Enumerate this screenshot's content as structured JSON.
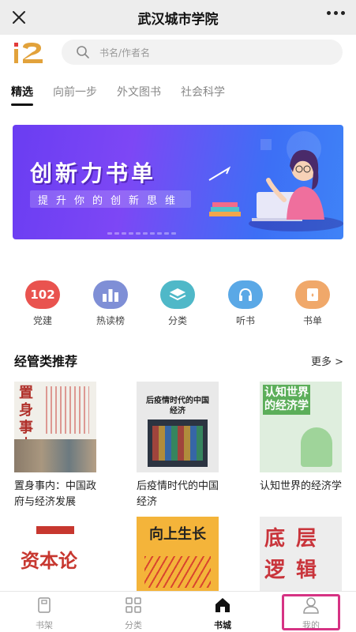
{
  "header": {
    "title": "武汉城市学院"
  },
  "logo": {
    "text": "i2"
  },
  "search": {
    "placeholder": "书名/作者名"
  },
  "tabs": [
    {
      "label": "精选",
      "active": true
    },
    {
      "label": "向前一步",
      "active": false
    },
    {
      "label": "外文图书",
      "active": false
    },
    {
      "label": "社会科学",
      "active": false
    }
  ],
  "banner": {
    "title": "创新力书单",
    "subtitle": "提升你的创新思维"
  },
  "quick_links": [
    {
      "label": "党建",
      "badge": "102",
      "color": "#e9534f",
      "icon": "party-badge-icon"
    },
    {
      "label": "热读榜",
      "color": "#7f8fd6",
      "icon": "ranking-icon"
    },
    {
      "label": "分类",
      "color": "#4fb8c8",
      "icon": "layers-icon"
    },
    {
      "label": "听书",
      "color": "#5aa8e6",
      "icon": "headphones-icon"
    },
    {
      "label": "书单",
      "color": "#f0a86a",
      "icon": "booklist-icon"
    }
  ],
  "section": {
    "title": "经管类推荐",
    "more": "更多 >"
  },
  "books": [
    {
      "title": "置身事内：中国政府与经济发展",
      "cover_text": "置身事内"
    },
    {
      "title": "后疫情时代的中国经济",
      "cover_text": "后疫情时代的中国经济"
    },
    {
      "title": "认知世界的经济学",
      "cover_text": "认知世界的经济学"
    },
    {
      "title": "",
      "cover_text": "资本论"
    },
    {
      "title": "",
      "cover_text": "向上生长"
    },
    {
      "title": "",
      "cover_text": "底层逻辑"
    }
  ],
  "bottom_nav": [
    {
      "label": "书架",
      "icon": "bookshelf-icon",
      "active": false
    },
    {
      "label": "分类",
      "icon": "category-grid-icon",
      "active": false
    },
    {
      "label": "书城",
      "icon": "home-icon",
      "active": true
    },
    {
      "label": "我的",
      "icon": "user-icon",
      "active": false
    }
  ]
}
